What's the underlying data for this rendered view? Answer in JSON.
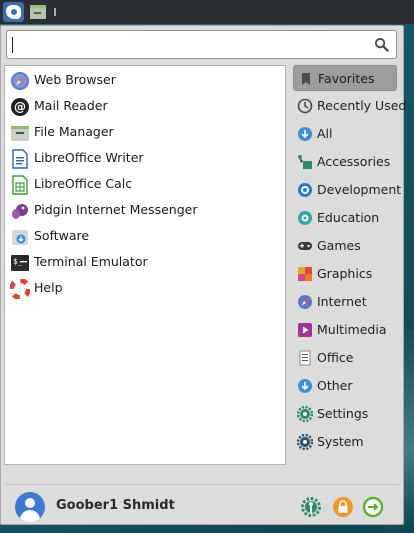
{
  "colors": {
    "panel": "#2b2f33",
    "menu_bg": "#dcdcdc",
    "selected_category": "#9d9d9d",
    "avatar": "#3b7bd4"
  },
  "search": {
    "value": "",
    "icon": "search-icon"
  },
  "favorites": [
    {
      "label": "Web Browser",
      "icon": "web-browser-icon"
    },
    {
      "label": "Mail Reader",
      "icon": "mail-reader-icon"
    },
    {
      "label": "File Manager",
      "icon": "file-manager-icon"
    },
    {
      "label": "LibreOffice Writer",
      "icon": "libreoffice-writer-icon"
    },
    {
      "label": "LibreOffice Calc",
      "icon": "libreoffice-calc-icon"
    },
    {
      "label": "Pidgin Internet Messenger",
      "icon": "pidgin-icon"
    },
    {
      "label": "Software",
      "icon": "software-icon"
    },
    {
      "label": "Terminal Emulator",
      "icon": "terminal-icon"
    },
    {
      "label": "Help",
      "icon": "help-icon"
    }
  ],
  "categories": [
    {
      "label": "Favorites",
      "icon": "bookmark-icon",
      "selected": true
    },
    {
      "label": "Recently Used",
      "icon": "clock-icon"
    },
    {
      "label": "All",
      "icon": "download-icon"
    },
    {
      "label": "Accessories",
      "icon": "accessories-icon"
    },
    {
      "label": "Development",
      "icon": "development-icon"
    },
    {
      "label": "Education",
      "icon": "education-icon"
    },
    {
      "label": "Games",
      "icon": "gamepad-icon"
    },
    {
      "label": "Graphics",
      "icon": "graphics-icon"
    },
    {
      "label": "Internet",
      "icon": "internet-icon"
    },
    {
      "label": "Multimedia",
      "icon": "multimedia-icon"
    },
    {
      "label": "Office",
      "icon": "office-icon"
    },
    {
      "label": "Other",
      "icon": "other-icon"
    },
    {
      "label": "Settings",
      "icon": "settings-icon"
    },
    {
      "label": "System",
      "icon": "system-icon"
    }
  ],
  "user": {
    "name": "Goober1 Shmidt"
  },
  "actions": [
    {
      "icon": "settings-manager-icon"
    },
    {
      "icon": "lock-screen-icon"
    },
    {
      "icon": "log-out-icon"
    }
  ]
}
